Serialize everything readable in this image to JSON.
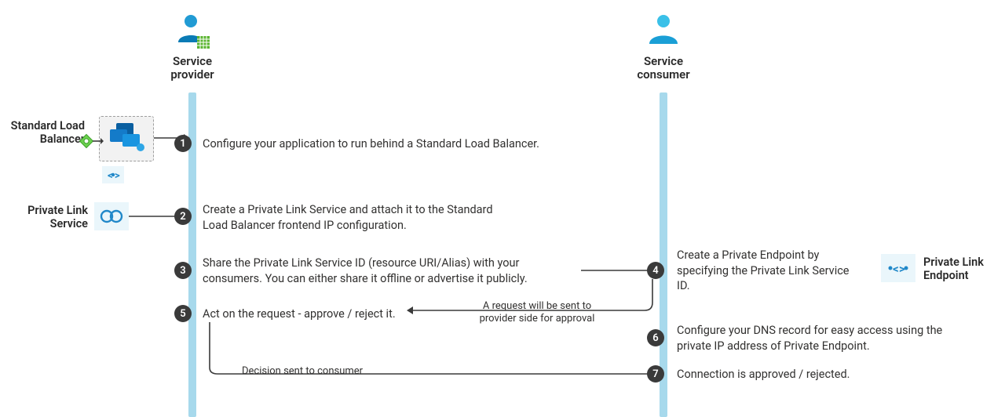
{
  "actors": {
    "provider": {
      "label": "Service\nprovider"
    },
    "consumer": {
      "label": "Service\nconsumer"
    }
  },
  "side_labels": {
    "load_balancer": "Standard Load\nBalancer",
    "private_link_service": "Private Link\nService",
    "private_link_endpoint": "Private Link\nEndpoint"
  },
  "steps": {
    "s1": {
      "num": "1",
      "text": "Configure your application to run behind a Standard Load Balancer."
    },
    "s2": {
      "num": "2",
      "text": "Create a Private Link Service and attach it to the Standard Load Balancer frontend IP configuration."
    },
    "s3": {
      "num": "3",
      "text": "Share the Private Link Service ID (resource URI/Alias) with your consumers. You can either share it offline or advertise it publicly."
    },
    "s4": {
      "num": "4",
      "text": "Create a Private Endpoint by specifying the Private Link Service ID."
    },
    "s5": {
      "num": "5",
      "text": "Act on the request - approve / reject it."
    },
    "s6": {
      "num": "6",
      "text": "Configure your DNS record for easy access using the private IP address of Private Endpoint."
    },
    "s7": {
      "num": "7",
      "text": "Connection is approved / rejected."
    }
  },
  "notes": {
    "request_sent": "A request will be sent to provider side for approval",
    "decision_sent": "Decision sent to consumer"
  }
}
